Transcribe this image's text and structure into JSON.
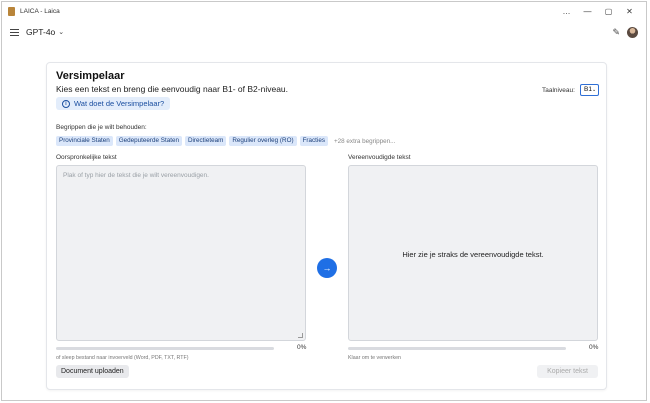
{
  "window": {
    "title": "LAICA - Laica",
    "controls": [
      "…",
      "—",
      "▢",
      "✕"
    ]
  },
  "topbar": {
    "model": "GPT-4o",
    "icons": [
      "menu-icon",
      "chevron-down-icon",
      "edit-icon",
      "avatar"
    ]
  },
  "tool": {
    "title": "Versimpelaar",
    "subtitle": "Kies een tekst en breng die eenvoudig naar B1- of B2-niveau.",
    "info_label": "Wat doet de Versimpelaar?",
    "level_label": "Taalniveau:",
    "level_value": "B1",
    "terms_label": "Begrippen die je wilt behouden:",
    "terms": [
      "Provinciale Staten",
      "Gedeputeerde Staten",
      "Directieteam",
      "Regulier overleg (RO)",
      "Fracties"
    ],
    "terms_more": "+28 extra begrippen..."
  },
  "input": {
    "label": "Oorspronkelijke tekst",
    "placeholder": "Plak of typ hier de tekst die je wilt vereenvoudigen.",
    "progress_pct": 0,
    "progress_text": "0%",
    "hint": "of sleep bestand naar invoerveld (Word, PDF, TXT, RTF)",
    "upload_label": "Document uploaden"
  },
  "output": {
    "label": "Vereenvoudigde tekst",
    "placeholder": "Hier zie je straks de vereenvoudigde tekst.",
    "progress_pct": 0,
    "progress_text": "0%",
    "hint": "Klaar om te verwerken",
    "copy_label": "Kopieer tekst"
  },
  "colors": {
    "accent": "#1f6fe5",
    "chip_bg": "#dbe7fa",
    "textarea_bg": "#f0f1f3"
  }
}
